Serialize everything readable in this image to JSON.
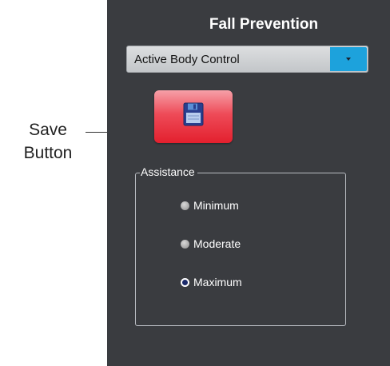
{
  "annotation": {
    "line1": "Save",
    "line2": "Button"
  },
  "panel": {
    "title": "Fall Prevention",
    "dropdown": {
      "value": "Active Body Control",
      "button_color": "#1da2dc"
    },
    "save_button": {
      "icon": "floppy-disk-icon",
      "color": "#e3202e"
    },
    "assistance": {
      "legend": "Assistance",
      "options": [
        {
          "label": "Minimum",
          "selected": false
        },
        {
          "label": "Moderate",
          "selected": false
        },
        {
          "label": "Maximum",
          "selected": true
        }
      ]
    }
  }
}
